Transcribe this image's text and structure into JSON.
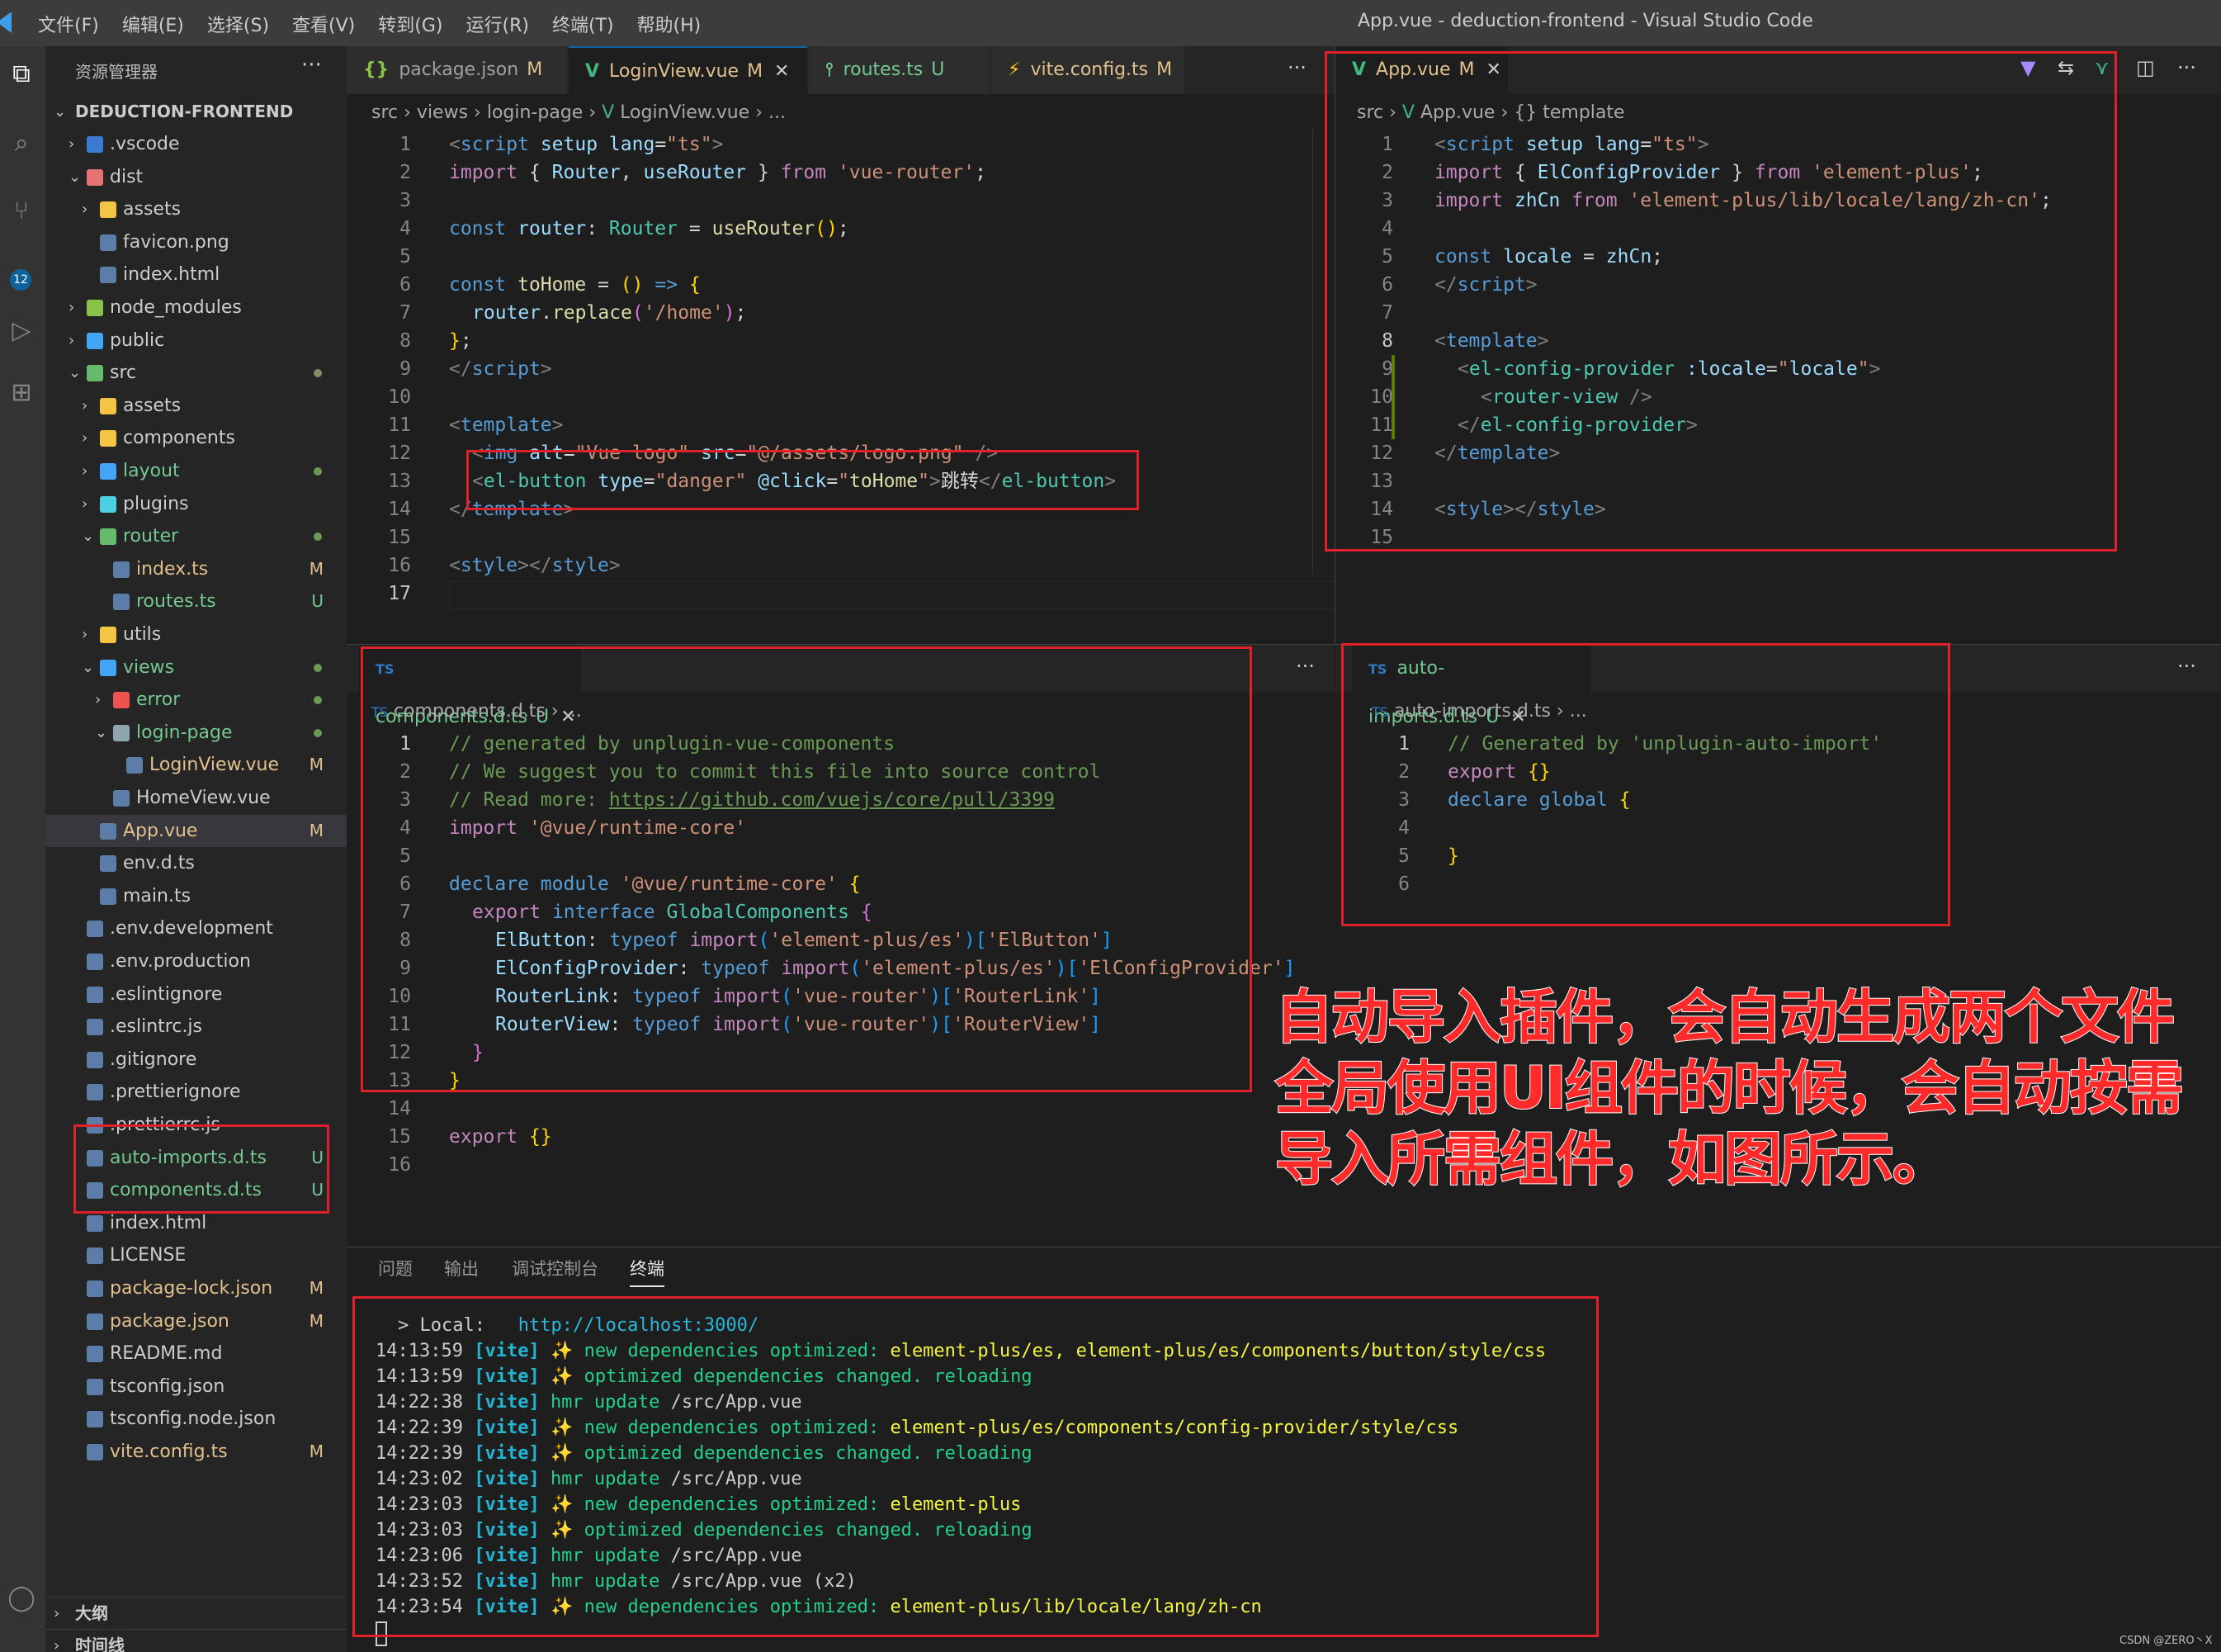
{
  "window": {
    "title": "App.vue - deduction-frontend - Visual Studio Code",
    "menu": [
      "文件(F)",
      "编辑(E)",
      "选择(S)",
      "查看(V)",
      "转到(G)",
      "运行(R)",
      "终端(T)",
      "帮助(H)"
    ]
  },
  "activity_bar": {
    "scm_badge": "12"
  },
  "sidebar": {
    "header": "资源管理器",
    "more": "···",
    "project": "DEDUCTION-FRONTEND",
    "items": [
      {
        "label": ".vscode",
        "depth": 1,
        "chev": "›",
        "status": ""
      },
      {
        "label": "dist",
        "depth": 1,
        "chev": "⌄",
        "status": ""
      },
      {
        "label": "assets",
        "depth": 2,
        "chev": "›",
        "status": ""
      },
      {
        "label": "favicon.png",
        "depth": 2,
        "chev": "",
        "status": ""
      },
      {
        "label": "index.html",
        "depth": 2,
        "chev": "",
        "status": ""
      },
      {
        "label": "node_modules",
        "depth": 1,
        "chev": "›",
        "status": ""
      },
      {
        "label": "public",
        "depth": 1,
        "chev": "›",
        "status": ""
      },
      {
        "label": "src",
        "depth": 1,
        "chev": "⌄",
        "status": "dot"
      },
      {
        "label": "assets",
        "depth": 2,
        "chev": "›",
        "status": ""
      },
      {
        "label": "components",
        "depth": 2,
        "chev": "›",
        "status": ""
      },
      {
        "label": "layout",
        "depth": 2,
        "chev": "›",
        "status": "dot"
      },
      {
        "label": "plugins",
        "depth": 2,
        "chev": "›",
        "status": ""
      },
      {
        "label": "router",
        "depth": 2,
        "chev": "⌄",
        "status": "dot"
      },
      {
        "label": "index.ts",
        "depth": 3,
        "chev": "",
        "status": "M"
      },
      {
        "label": "routes.ts",
        "depth": 3,
        "chev": "",
        "status": "U"
      },
      {
        "label": "utils",
        "depth": 2,
        "chev": "›",
        "status": ""
      },
      {
        "label": "views",
        "depth": 2,
        "chev": "⌄",
        "status": "dot"
      },
      {
        "label": "error",
        "depth": 3,
        "chev": "›",
        "status": "dot"
      },
      {
        "label": "login-page",
        "depth": 3,
        "chev": "⌄",
        "status": "dot"
      },
      {
        "label": "LoginView.vue",
        "depth": 4,
        "chev": "",
        "status": "M"
      },
      {
        "label": "HomeView.vue",
        "depth": 3,
        "chev": "",
        "status": ""
      },
      {
        "label": "App.vue",
        "depth": 2,
        "chev": "",
        "status": "M"
      },
      {
        "label": "env.d.ts",
        "depth": 2,
        "chev": "",
        "status": ""
      },
      {
        "label": "main.ts",
        "depth": 2,
        "chev": "",
        "status": ""
      },
      {
        "label": ".env.development",
        "depth": 1,
        "chev": "",
        "status": ""
      },
      {
        "label": ".env.production",
        "depth": 1,
        "chev": "",
        "status": ""
      },
      {
        "label": ".eslintignore",
        "depth": 1,
        "chev": "",
        "status": ""
      },
      {
        "label": ".eslintrc.js",
        "depth": 1,
        "chev": "",
        "status": ""
      },
      {
        "label": ".gitignore",
        "depth": 1,
        "chev": "",
        "status": ""
      },
      {
        "label": ".prettierignore",
        "depth": 1,
        "chev": "",
        "status": ""
      },
      {
        "label": ".prettierrc.js",
        "depth": 1,
        "chev": "",
        "status": ""
      },
      {
        "label": "auto-imports.d.ts",
        "depth": 1,
        "chev": "",
        "status": "U"
      },
      {
        "label": "components.d.ts",
        "depth": 1,
        "chev": "",
        "status": "U"
      },
      {
        "label": "index.html",
        "depth": 1,
        "chev": "",
        "status": ""
      },
      {
        "label": "LICENSE",
        "depth": 1,
        "chev": "",
        "status": ""
      },
      {
        "label": "package-lock.json",
        "depth": 1,
        "chev": "",
        "status": "M"
      },
      {
        "label": "package.json",
        "depth": 1,
        "chev": "",
        "status": "M"
      },
      {
        "label": "README.md",
        "depth": 1,
        "chev": "",
        "status": ""
      },
      {
        "label": "tsconfig.json",
        "depth": 1,
        "chev": "",
        "status": ""
      },
      {
        "label": "tsconfig.node.json",
        "depth": 1,
        "chev": "",
        "status": ""
      },
      {
        "label": "vite.config.ts",
        "depth": 1,
        "chev": "",
        "status": "M"
      }
    ],
    "outline": "大纲",
    "timeline": "时间线"
  },
  "editor_top_left": {
    "tabs": [
      {
        "label": "package.json",
        "status": "M",
        "active": false
      },
      {
        "label": "LoginView.vue",
        "status": "M",
        "active": true
      },
      {
        "label": "routes.ts",
        "status": "U",
        "active": false
      },
      {
        "label": "vite.config.ts",
        "status": "M",
        "active": false
      }
    ],
    "more": "···",
    "breadcrumb": [
      "src",
      "views",
      "login-page",
      "LoginView.vue",
      "..."
    ],
    "line_numbers": [
      "1",
      "2",
      "3",
      "4",
      "5",
      "6",
      "7",
      "8",
      "9",
      "10",
      "11",
      "12",
      "13",
      "14",
      "15",
      "16",
      "17"
    ]
  },
  "editor_top_right": {
    "tab": {
      "label": "App.vue",
      "status": "M"
    },
    "breadcrumb": [
      "src",
      "App.vue",
      "{} template"
    ],
    "line_numbers": [
      "1",
      "2",
      "3",
      "4",
      "5",
      "6",
      "7",
      "8",
      "9",
      "10",
      "11",
      "12",
      "13",
      "14",
      "15"
    ]
  },
  "editor_bottom_left": {
    "tab": {
      "label": "components.d.ts",
      "status": "U"
    },
    "more": "···",
    "breadcrumb": [
      "components.d.ts",
      "..."
    ],
    "line_numbers": [
      "1",
      "2",
      "3",
      "4",
      "5",
      "6",
      "7",
      "8",
      "9",
      "10",
      "11",
      "12",
      "13",
      "14",
      "15",
      "16"
    ]
  },
  "editor_bottom_right": {
    "tab": {
      "label": "auto-imports.d.ts",
      "status": "U"
    },
    "more": "···",
    "breadcrumb": [
      "auto-imports.d.ts",
      "..."
    ],
    "line_numbers": [
      "1",
      "2",
      "3",
      "4",
      "5",
      "6"
    ]
  },
  "panel": {
    "tabs": [
      "问题",
      "输出",
      "调试控制台",
      "终端"
    ],
    "active_tab": "终端",
    "local_label": "> Local:",
    "local_url": "http://localhost:3000/",
    "lines": [
      {
        "time": "14:13:59",
        "tag": "[vite]",
        "spark": true,
        "msg": "new dependencies optimized:",
        "extra": "element-plus/es, element-plus/es/components/button/style/css"
      },
      {
        "time": "14:13:59",
        "tag": "[vite]",
        "spark": true,
        "msg": "optimized dependencies changed. reloading",
        "extra": ""
      },
      {
        "time": "14:22:38",
        "tag": "[vite]",
        "spark": false,
        "msg": "hmr update",
        "extra": "/src/App.vue"
      },
      {
        "time": "14:22:39",
        "tag": "[vite]",
        "spark": true,
        "msg": "new dependencies optimized:",
        "extra": "element-plus/es/components/config-provider/style/css"
      },
      {
        "time": "14:22:39",
        "tag": "[vite]",
        "spark": true,
        "msg": "optimized dependencies changed. reloading",
        "extra": ""
      },
      {
        "time": "14:23:02",
        "tag": "[vite]",
        "spark": false,
        "msg": "hmr update",
        "extra": "/src/App.vue"
      },
      {
        "time": "14:23:03",
        "tag": "[vite]",
        "spark": true,
        "msg": "new dependencies optimized:",
        "extra": "element-plus"
      },
      {
        "time": "14:23:03",
        "tag": "[vite]",
        "spark": true,
        "msg": "optimized dependencies changed. reloading",
        "extra": ""
      },
      {
        "time": "14:23:06",
        "tag": "[vite]",
        "spark": false,
        "msg": "hmr update",
        "extra": "/src/App.vue"
      },
      {
        "time": "14:23:52",
        "tag": "[vite]",
        "spark": false,
        "msg": "hmr update",
        "extra": "/src/App.vue (x2)"
      },
      {
        "time": "14:23:54",
        "tag": "[vite]",
        "spark": true,
        "msg": "new dependencies optimized:",
        "extra": "element-plus/lib/locale/lang/zh-cn"
      }
    ]
  },
  "annotation": {
    "lines": [
      "自动导入插件，会自动生成两个文件",
      "全局使用UI组件的时候，会自动按需",
      "导入所需组件，如图所示。"
    ]
  },
  "watermark": "CSDN @ZERO丶X",
  "colors": {
    "accent": "#0e639c",
    "annotation_red": "#e0202a"
  }
}
